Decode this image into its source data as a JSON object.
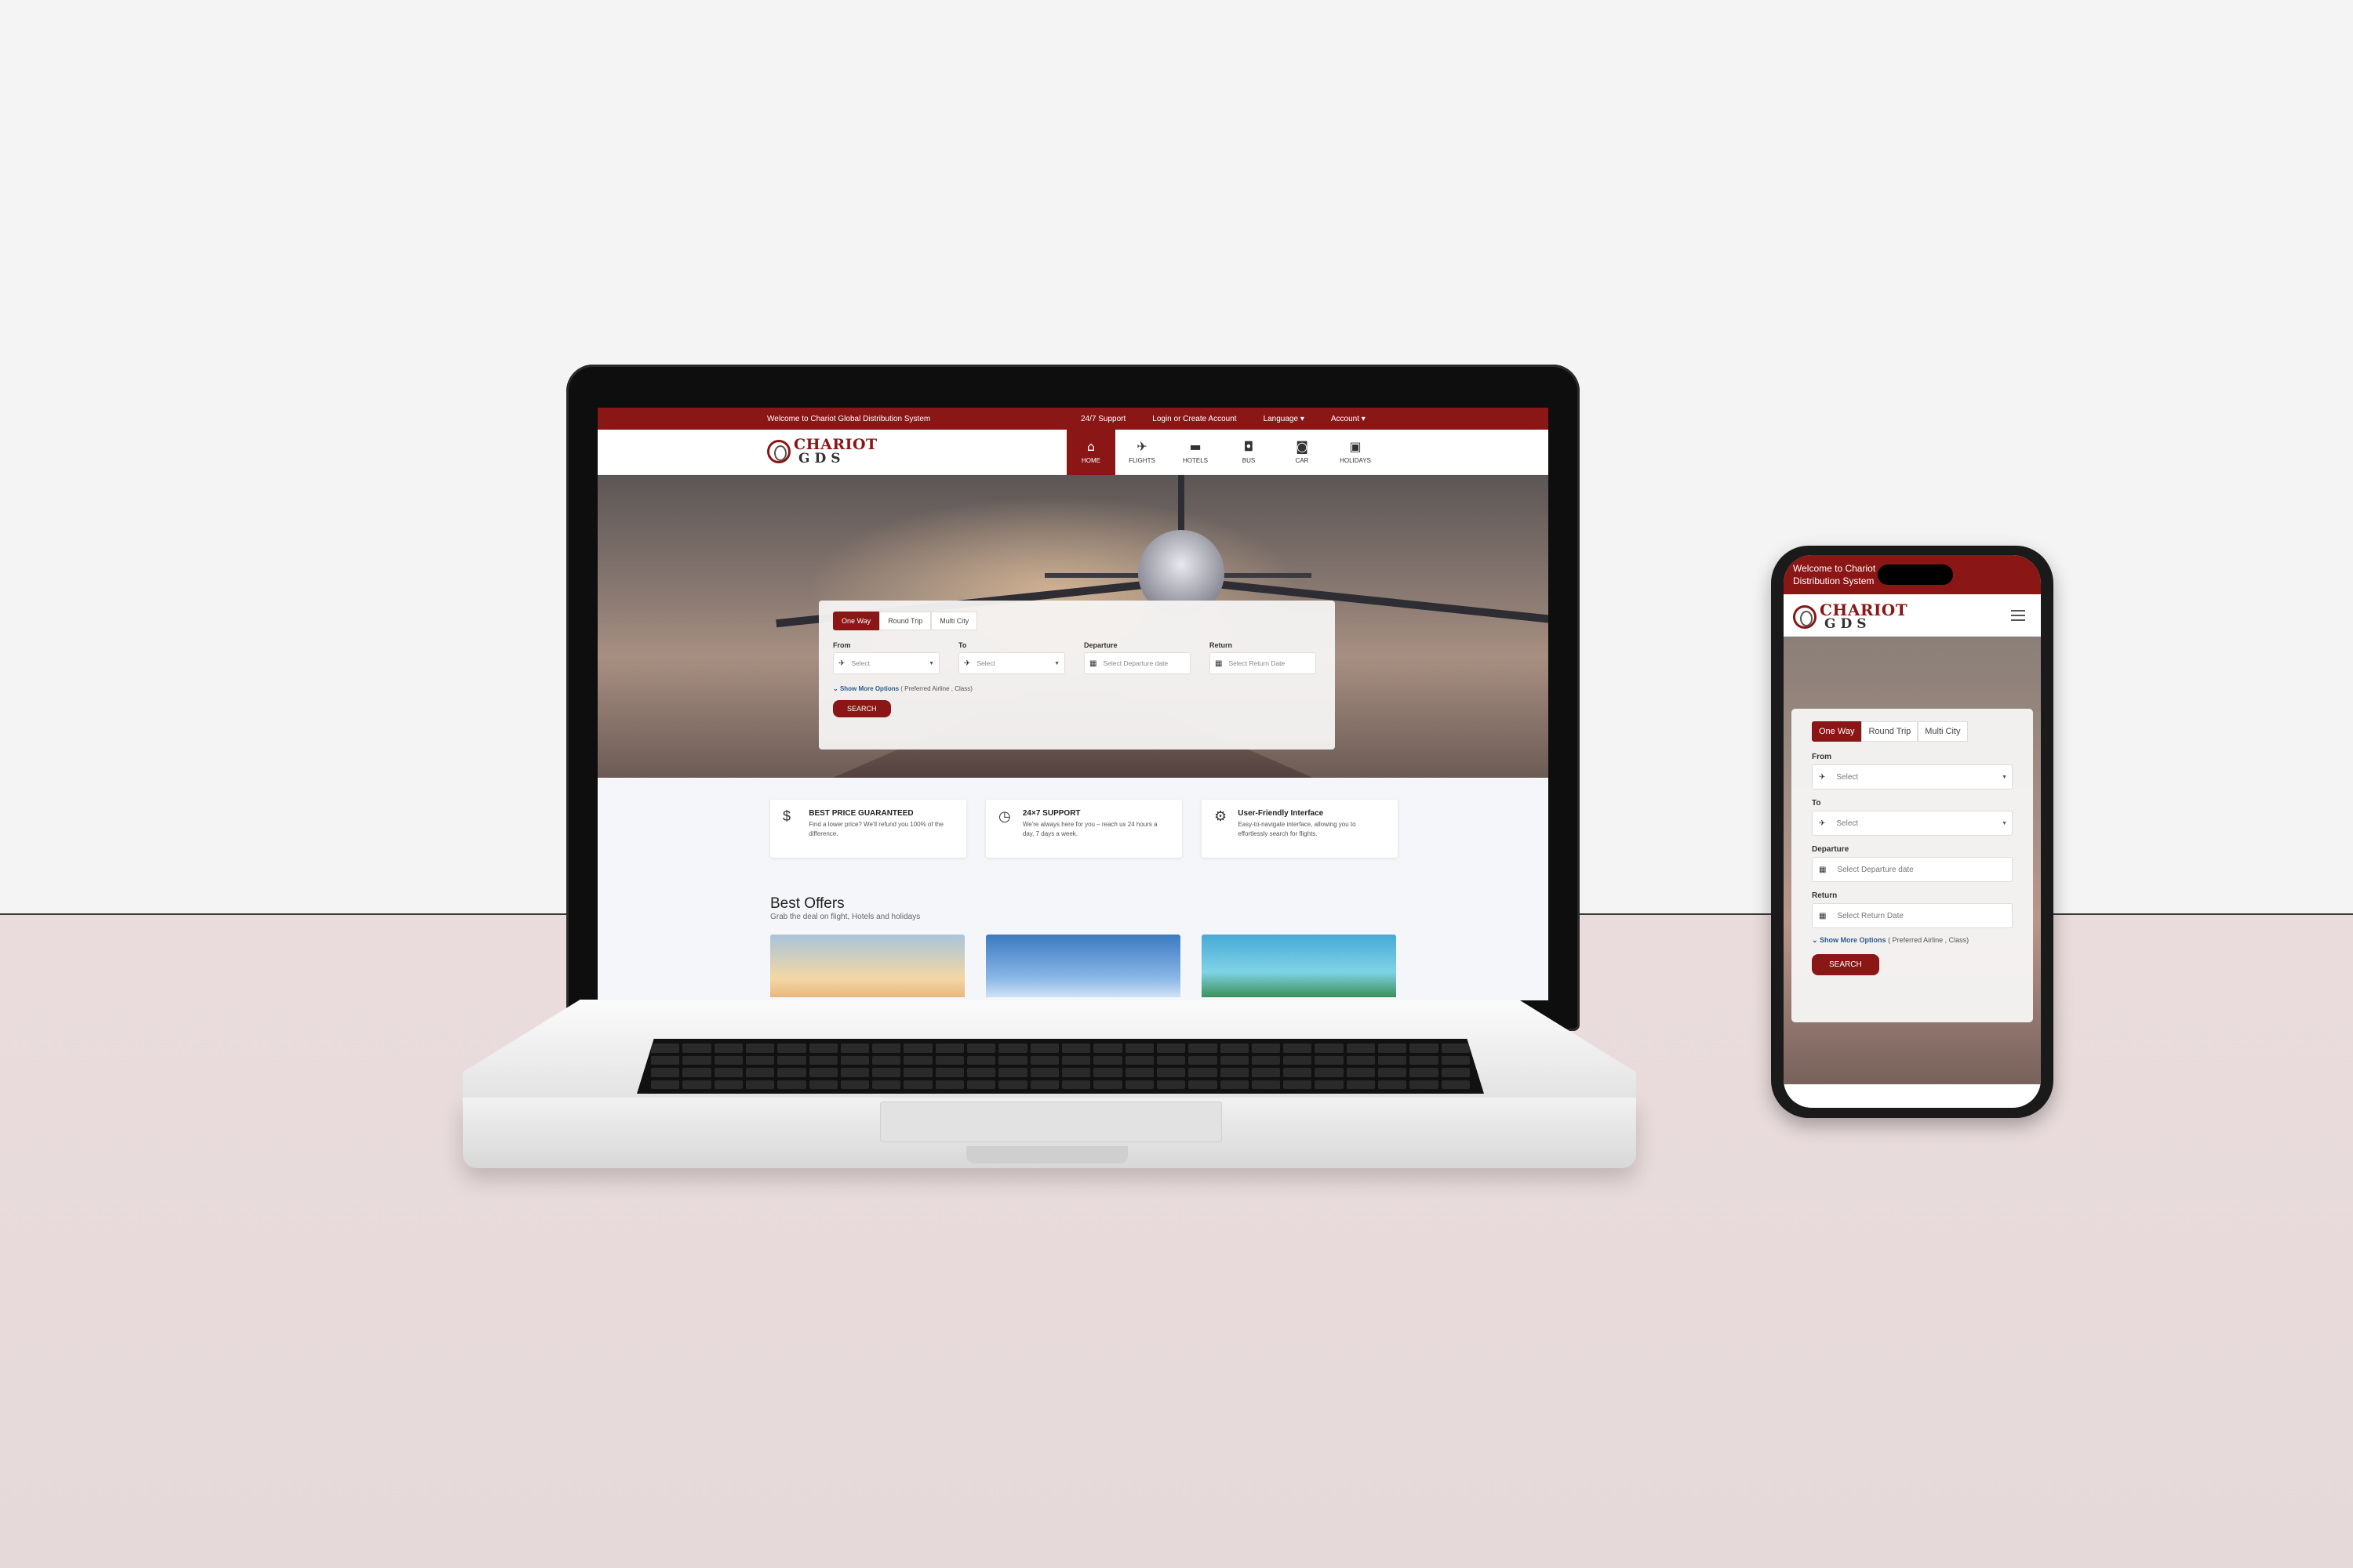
{
  "site": {
    "topbar": {
      "welcome": "Welcome to Chariot Global Distribution System",
      "support": "24/7 Support",
      "login": "Login or Create Account",
      "language": "Language ▾",
      "account": "Account ▾"
    },
    "logo": {
      "line1": "CHARIOT",
      "line2": "GDS"
    },
    "nav": [
      {
        "label": "HOME",
        "icon": "home-icon",
        "glyph": "⌂"
      },
      {
        "label": "FLIGHTS",
        "icon": "plane-icon",
        "glyph": "✈"
      },
      {
        "label": "HOTELS",
        "icon": "bed-icon",
        "glyph": "▬"
      },
      {
        "label": "BUS",
        "icon": "bus-icon",
        "glyph": "◘"
      },
      {
        "label": "CAR",
        "icon": "car-icon",
        "glyph": "◙"
      },
      {
        "label": "HOLIDAYS",
        "icon": "suitcase-icon",
        "glyph": "▣"
      }
    ],
    "search": {
      "tabs": [
        "One Way",
        "Round Trip",
        "Multi City"
      ],
      "from_label": "From",
      "from_placeholder": "Select",
      "to_label": "To",
      "to_placeholder": "Select",
      "departure_label": "Departure",
      "departure_placeholder": "Select Departure date",
      "return_label": "Return",
      "return_placeholder": "Select Return Date",
      "more_link": "Show More Options",
      "more_note": "( Preferred Airline , Class)",
      "button": "SEARCH"
    },
    "features": [
      {
        "title": "BEST PRICE GUARANTEED",
        "text": "Find a lower price? We'll refund you 100% of the difference.",
        "icon": "money-hand-icon",
        "glyph": "$"
      },
      {
        "title": "24×7 SUPPORT",
        "text": "We're always here for you – reach us 24 hours a day, 7 days a week.",
        "icon": "clock-icon",
        "glyph": "◷"
      },
      {
        "title": "User-Friendly Interface",
        "text": "Easy-to-navigate interface, allowing you to effortlessly search for flights.",
        "icon": "gear-icon",
        "glyph": "⚙"
      }
    ],
    "offers": {
      "title": "Best Offers",
      "subtitle": "Grab the deal on flight, Hotels and holidays"
    }
  },
  "mobile": {
    "topbar": "Welcome to Chariot Global Distribution System",
    "topbar_visible": "Welcome to Chariot",
    "topbar_line2": "Distribution System",
    "search": {
      "tabs": [
        "One Way",
        "Round Trip",
        "Multi City"
      ],
      "from_label": "From",
      "from_placeholder": "Select",
      "to_label": "To",
      "to_placeholder": "Select",
      "departure_label": "Departure",
      "departure_placeholder": "Select Departure date",
      "return_label": "Return",
      "return_placeholder": "Select Return Date",
      "more_link": "Show More Options",
      "more_note": "( Preferred Airline , Class)",
      "button": "SEARCH"
    }
  },
  "colors": {
    "brand": "#8a1616",
    "link": "#2a5c8a"
  }
}
